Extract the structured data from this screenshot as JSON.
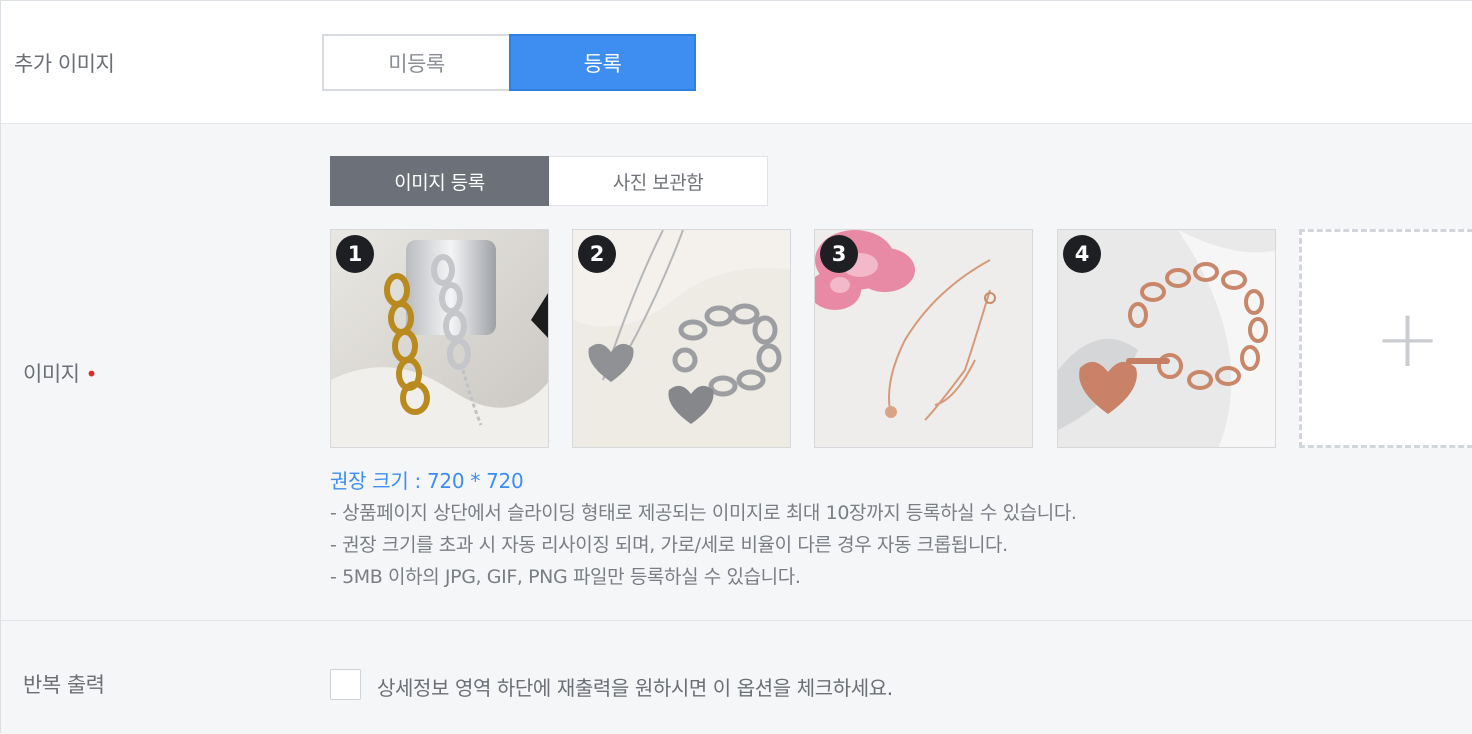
{
  "additional_image": {
    "label": "추가 이미지",
    "options": [
      "미등록",
      "등록"
    ],
    "selected": "등록"
  },
  "image_section": {
    "label": "이미지",
    "required_mark": "•",
    "tabs": [
      "이미지 등록",
      "사진 보관함"
    ],
    "active_tab": "이미지 등록",
    "images": [
      {
        "index": "1",
        "icon": "gold-silver-chain-bracelet-photo"
      },
      {
        "index": "2",
        "icon": "silver-heart-necklace-bracelet-photo"
      },
      {
        "index": "3",
        "icon": "rose-gold-bracelet-flower-photo"
      },
      {
        "index": "4",
        "icon": "rose-gold-heart-charm-bracelet-photo"
      }
    ],
    "add_icon": "+",
    "recommended_size": "권장 크기 : 720 * 720",
    "hints": [
      "- 상품페이지 상단에서 슬라이딩 형태로 제공되는 이미지로 최대 10장까지 등록하실 수 있습니다.",
      "- 권장 크기를 초과 시 자동 리사이징 되며, 가로/세로 비율이 다른 경우 자동 크롭됩니다.",
      "- 5MB 이하의 JPG, GIF, PNG 파일만 등록하실 수 있습니다."
    ]
  },
  "repeat_output": {
    "label": "반복 출력",
    "checkbox_label": "상세정보 영역 하단에 재출력을 원하시면 이 옵션을 체크하세요.",
    "checked": false
  },
  "colors": {
    "accent": "#3d8ef0",
    "tab_active": "#6b7079",
    "required": "#e02a2a",
    "section_bg": "#f5f6f8"
  }
}
